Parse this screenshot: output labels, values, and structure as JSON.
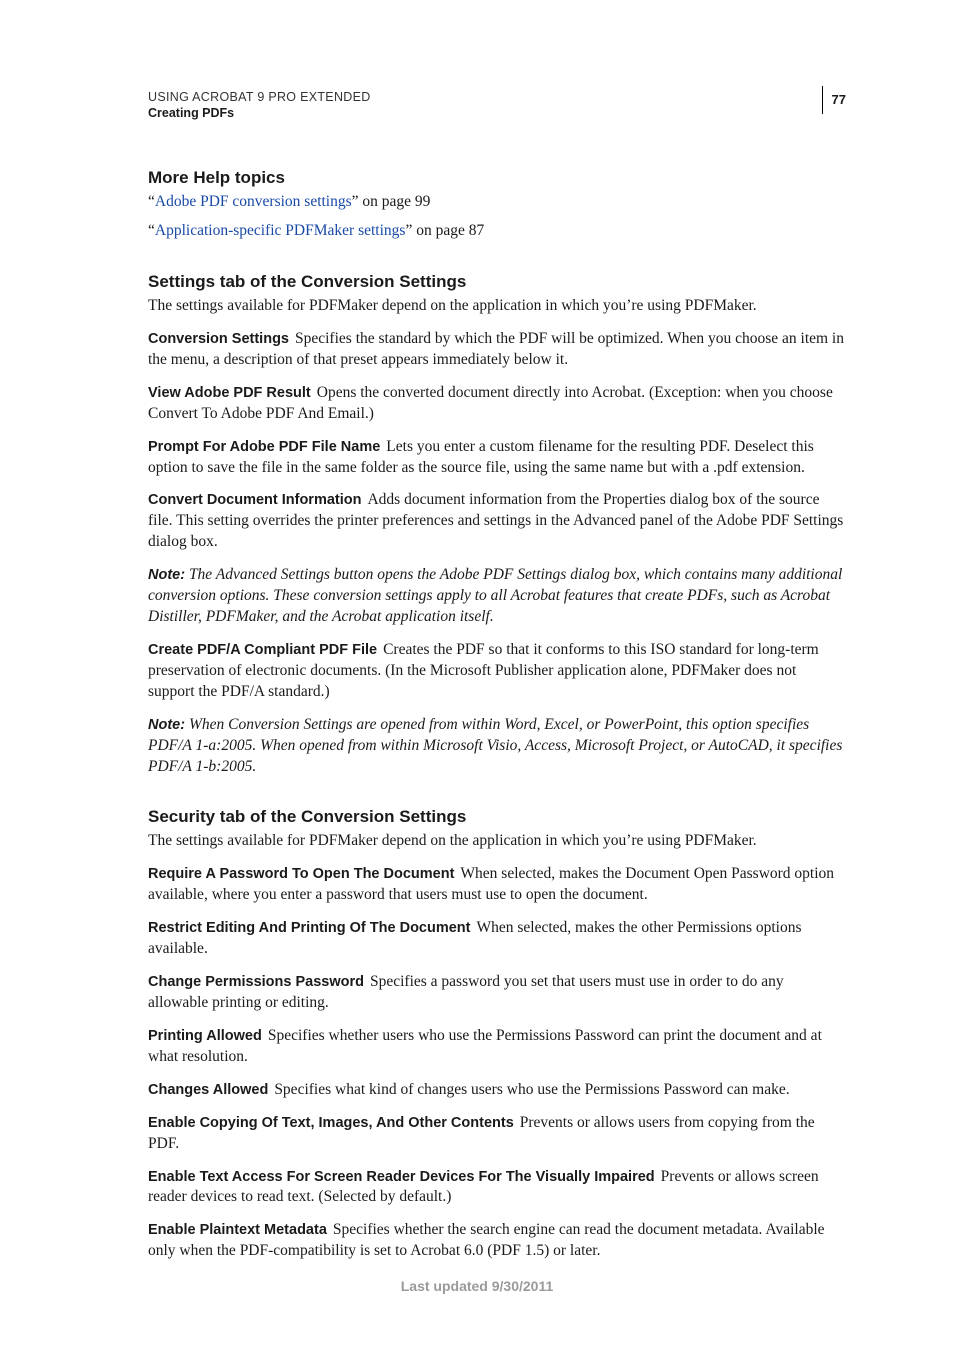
{
  "header": {
    "line1": "USING ACROBAT 9 PRO EXTENDED",
    "line2": "Creating PDFs",
    "pageNumber": "77"
  },
  "moreHelp": {
    "heading": "More Help topics",
    "items": [
      {
        "quoteOpen": "“",
        "linkText": "Adobe PDF conversion settings",
        "tail": "” on page 99"
      },
      {
        "quoteOpen": "“",
        "linkText": "Application-specific PDFMaker settings",
        "tail": "” on page 87"
      }
    ]
  },
  "settingsSection": {
    "heading": "Settings tab of the Conversion Settings",
    "intro": "The settings available for PDFMaker depend on the application in which you’re using PDFMaker.",
    "items": [
      {
        "term": "Conversion Settings",
        "body": "Specifies the standard by which the PDF will be optimized. When you choose an item in the menu, a description of that preset appears immediately below it."
      },
      {
        "term": "View Adobe PDF Result",
        "body": "Opens the converted document directly into Acrobat. (Exception: when you choose Convert To Adobe PDF And Email.)"
      },
      {
        "term": "Prompt For Adobe PDF File Name",
        "body": "Lets you enter a custom filename for the resulting PDF. Deselect this option to save the file in the same folder as the source file, using the same name but with a .pdf extension."
      },
      {
        "term": "Convert Document Information",
        "body": "Adds document information from the Properties dialog box of the source file. This setting overrides the printer preferences and settings in the Advanced panel of the Adobe PDF Settings dialog box."
      }
    ],
    "note1": {
      "label": "Note:",
      "body": "The Advanced Settings button opens the Adobe PDF Settings dialog box, which contains many additional conversion options. These conversion settings apply to all Acrobat features that create PDFs, such as Acrobat Distiller, PDFMaker, and the Acrobat application itself."
    },
    "item5": {
      "term": "Create PDF/A Compliant PDF File",
      "body": "Creates the PDF so that it conforms to this ISO standard for long-term preservation of electronic documents. (In the Microsoft Publisher application alone, PDFMaker does not support the PDF/A standard.)"
    },
    "note2": {
      "label": "Note:",
      "body": "When Conversion Settings are opened from within Word, Excel, or PowerPoint, this option specifies PDF/A 1-a:2005. When opened from within Microsoft Visio, Access, Microsoft Project, or AutoCAD, it specifies PDF/A 1-b:2005."
    }
  },
  "securitySection": {
    "heading": "Security tab of the Conversion Settings",
    "intro": "The settings available for PDFMaker depend on the application in which you’re using PDFMaker.",
    "items": [
      {
        "term": "Require A Password To Open The Document",
        "body": "When selected, makes the Document Open Password option available, where you enter a password that users must use to open the document."
      },
      {
        "term": "Restrict Editing And Printing Of The Document",
        "body": "When selected, makes the other Permissions options available."
      },
      {
        "term": "Change Permissions Password",
        "body": "Specifies a password you set that users must use in order to do any allowable printing or editing."
      },
      {
        "term": "Printing Allowed",
        "body": "Specifies whether users who use the Permissions Password can print the document and at what resolution."
      },
      {
        "term": "Changes Allowed",
        "body": "Specifies what kind of changes users who use the Permissions Password can make."
      },
      {
        "term": "Enable Copying Of Text, Images, And Other Contents",
        "body": "Prevents or allows users from copying from the PDF."
      },
      {
        "term": "Enable Text Access For Screen Reader Devices For The Visually Impaired",
        "body": "Prevents or allows screen reader devices to read text. (Selected by default.)"
      },
      {
        "term": "Enable Plaintext Metadata",
        "body": "Specifies whether the search engine can read the document metadata. Available only when the PDF-compatibility is set to Acrobat 6.0 (PDF 1.5) or later."
      }
    ]
  },
  "footer": "Last updated 9/30/2011"
}
